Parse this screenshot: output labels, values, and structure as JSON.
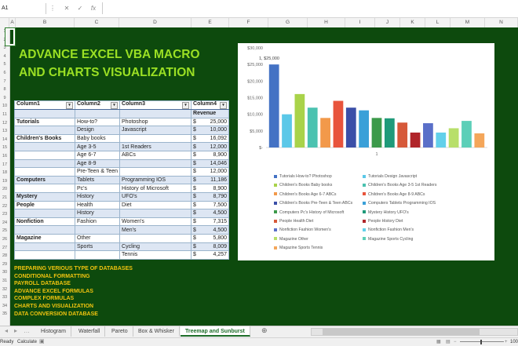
{
  "formula_bar": {
    "name_box": "A1",
    "fx": "fx"
  },
  "columns": [
    "A",
    "B",
    "C",
    "D",
    "E",
    "F",
    "G",
    "H",
    "I",
    "J",
    "K",
    "L",
    "M",
    "N"
  ],
  "rows": [
    "1",
    "2",
    "3",
    "4",
    "5",
    "6",
    "7",
    "8",
    "9",
    "10",
    "11",
    "12",
    "13",
    "14",
    "15",
    "16",
    "17",
    "18",
    "19",
    "20",
    "21",
    "22",
    "23",
    "24",
    "25",
    "26",
    "27",
    "28",
    "29",
    "30",
    "31",
    "32",
    "33",
    "34",
    "35"
  ],
  "title": {
    "line1": "ADVANCE EXCEL VBA MACRO",
    "line2": "AND CHARTS VISUALIZATION"
  },
  "table": {
    "headers": [
      "Column1",
      "Column2",
      "Column3",
      "Column4"
    ],
    "subheader": "Revenue",
    "currency": "$",
    "rows": [
      {
        "c1": "Tutorials",
        "c2": "How-to?",
        "c3": "Photoshop",
        "v": "25,000"
      },
      {
        "c1": "",
        "c2": "Design",
        "c3": "Javascript",
        "v": "10,000"
      },
      {
        "c1": "Children's Books",
        "c2": "Baby books",
        "c3": "",
        "v": "16,092"
      },
      {
        "c1": "",
        "c2": "Age 3-5",
        "c3": "1st Readers",
        "v": "12,000"
      },
      {
        "c1": "",
        "c2": "Age 6-7",
        "c3": "ABCs",
        "v": "8,900"
      },
      {
        "c1": "",
        "c2": "Age 8-9",
        "c3": "",
        "v": "14,046"
      },
      {
        "c1": "",
        "c2": "Pre-Teen & Teen",
        "c3": "",
        "v": "12,000"
      },
      {
        "c1": "Computers",
        "c2": "Tablets",
        "c3": "Programming IOS",
        "v": "11,186"
      },
      {
        "c1": "",
        "c2": "Pc's",
        "c3": "History of Microsoft",
        "v": "8,900"
      },
      {
        "c1": "Mystery",
        "c2": "History",
        "c3": "UFO's",
        "v": "8,790"
      },
      {
        "c1": "People",
        "c2": "Health",
        "c3": "Diet",
        "v": "7,500"
      },
      {
        "c1": "",
        "c2": "History",
        "c3": "",
        "v": "4,500"
      },
      {
        "c1": "Nonfiction",
        "c2": "Fashion",
        "c3": "Women's",
        "v": "7,315"
      },
      {
        "c1": "",
        "c2": "",
        "c3": "Men's",
        "v": "4,500"
      },
      {
        "c1": "Magazine",
        "c2": "Other",
        "c3": "",
        "v": "5,800"
      },
      {
        "c1": "",
        "c2": "Sports",
        "c3": "Cycling",
        "v": "8,009"
      },
      {
        "c1": "",
        "c2": "",
        "c3": "Tennis",
        "v": "4,257"
      }
    ]
  },
  "bullets": [
    "PREPARING VERIOUS TYPE OF DATABASES",
    "CONDITIONAL FORMATTING",
    "PAYROLL DATABASE",
    "ADVANCE EXCEL FORMULAS",
    "COMPLEX FORMULAS",
    "CHARTS AND VISUALIZATION",
    "DATA CONVERSION DATABASE"
  ],
  "chart_data": {
    "type": "bar",
    "categories": [
      "1"
    ],
    "yticks": [
      "$30,000",
      "$25,000",
      "$20,000",
      "$15,000",
      "$10,000",
      "$5,000",
      "$-"
    ],
    "ylim": [
      0,
      30000
    ],
    "data_label": "1, $25,000",
    "series": [
      {
        "name": "Tutorials How-to? Photoshop",
        "values": [
          25000
        ],
        "color": "#4472c4"
      },
      {
        "name": "Tutorials Design Javascript",
        "values": [
          10000
        ],
        "color": "#5bc8e8"
      },
      {
        "name": "Children's Books Baby books",
        "values": [
          16092
        ],
        "color": "#a9d34a"
      },
      {
        "name": "Children's Books Age 3-5 1st Readers",
        "values": [
          12000
        ],
        "color": "#4bc2b0"
      },
      {
        "name": "Children's Books Age 6-7 ABCs",
        "values": [
          8900
        ],
        "color": "#f2994a"
      },
      {
        "name": "Children's Books Age 8-9 ABCs",
        "values": [
          14046
        ],
        "color": "#e8543c"
      },
      {
        "name": "Children's Books Pre-Teen & Teen ABCs",
        "values": [
          12000
        ],
        "color": "#3b4fa8"
      },
      {
        "name": "Computers Tablets Programming IOS",
        "values": [
          11186
        ],
        "color": "#3aa0d8"
      },
      {
        "name": "Computers Pc's History of Microsoft",
        "values": [
          8900
        ],
        "color": "#3c9a4a"
      },
      {
        "name": "Mystery History UFO's",
        "values": [
          8790
        ],
        "color": "#1f9a7a"
      },
      {
        "name": "People Health Diet",
        "values": [
          7500
        ],
        "color": "#d6593a"
      },
      {
        "name": "People History Diet",
        "values": [
          4500
        ],
        "color": "#b0252a"
      },
      {
        "name": "Nonfiction Fashion Women's",
        "values": [
          7315
        ],
        "color": "#5a6fc8"
      },
      {
        "name": "Nonfiction Fashion Men's",
        "values": [
          4500
        ],
        "color": "#62d0ea"
      },
      {
        "name": "Magazine Other",
        "values": [
          5800
        ],
        "color": "#b8df6a"
      },
      {
        "name": "Magazine Sports Cycling",
        "values": [
          8009
        ],
        "color": "#5ccfb8"
      },
      {
        "name": "Magazine Sports Tennis",
        "values": [
          4257
        ],
        "color": "#f4a65a"
      }
    ]
  },
  "tabs": [
    "Histogram",
    "Waterfall",
    "Pareto",
    "Box & Whisker",
    "Treemap and Sunburst"
  ],
  "active_tab": "Treemap and Sunburst",
  "status": {
    "ready": "Ready",
    "calc": "Calculate",
    "zoom": "100"
  }
}
